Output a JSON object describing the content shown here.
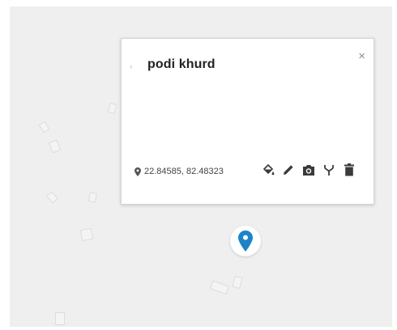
{
  "place": {
    "name": "podi khurd",
    "coordinates": "22.84585, 82.48323"
  },
  "colors": {
    "map_background": "#f0eff0",
    "marker_blue": "#1c84c6",
    "icon_dark": "#3a3a3a"
  },
  "icons": {
    "back": "chevron-left-icon",
    "close": "close-icon",
    "location": "location-pin-icon",
    "actions": [
      "paint-bucket-icon",
      "pencil-icon",
      "camera-icon",
      "fork-icon",
      "trash-icon"
    ],
    "marker": "map-marker-icon"
  },
  "close_glyph": "×",
  "back_glyph": "‹"
}
